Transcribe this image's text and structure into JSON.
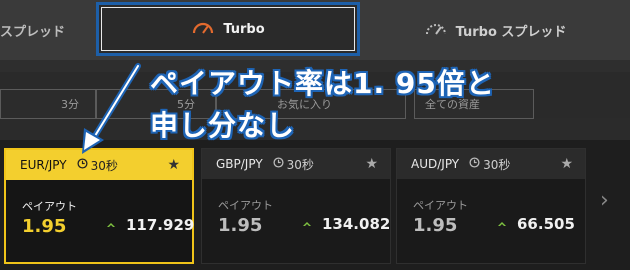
{
  "tabs": {
    "left": "スプレッド",
    "turbo": "Turbo",
    "turbo_spread": "Turbo スプレッド"
  },
  "filters": {
    "f1": "3分",
    "f2": "5分",
    "f3": "お気に入り",
    "f4": "全ての資産"
  },
  "cards": [
    {
      "pair": "EUR/JPY",
      "time": "30秒",
      "payout_label": "ペイアウト",
      "payout": "1.95",
      "price": "117.929"
    },
    {
      "pair": "GBP/JPY",
      "time": "30秒",
      "payout_label": "ペイアウト",
      "payout": "1.95",
      "price": "134.082"
    },
    {
      "pair": "AUD/JPY",
      "time": "30秒",
      "payout_label": "ペイアウト",
      "payout": "1.95",
      "price": "66.505"
    }
  ],
  "annotation": {
    "line1": "ペイアウト率は1. 95倍と",
    "line2": "申し分なし"
  },
  "colors": {
    "accent_yellow": "#f3cf2e",
    "annotation_blue": "#1e64b5",
    "up_green": "#7fc241",
    "turbo_icon": "#e36a2e"
  }
}
